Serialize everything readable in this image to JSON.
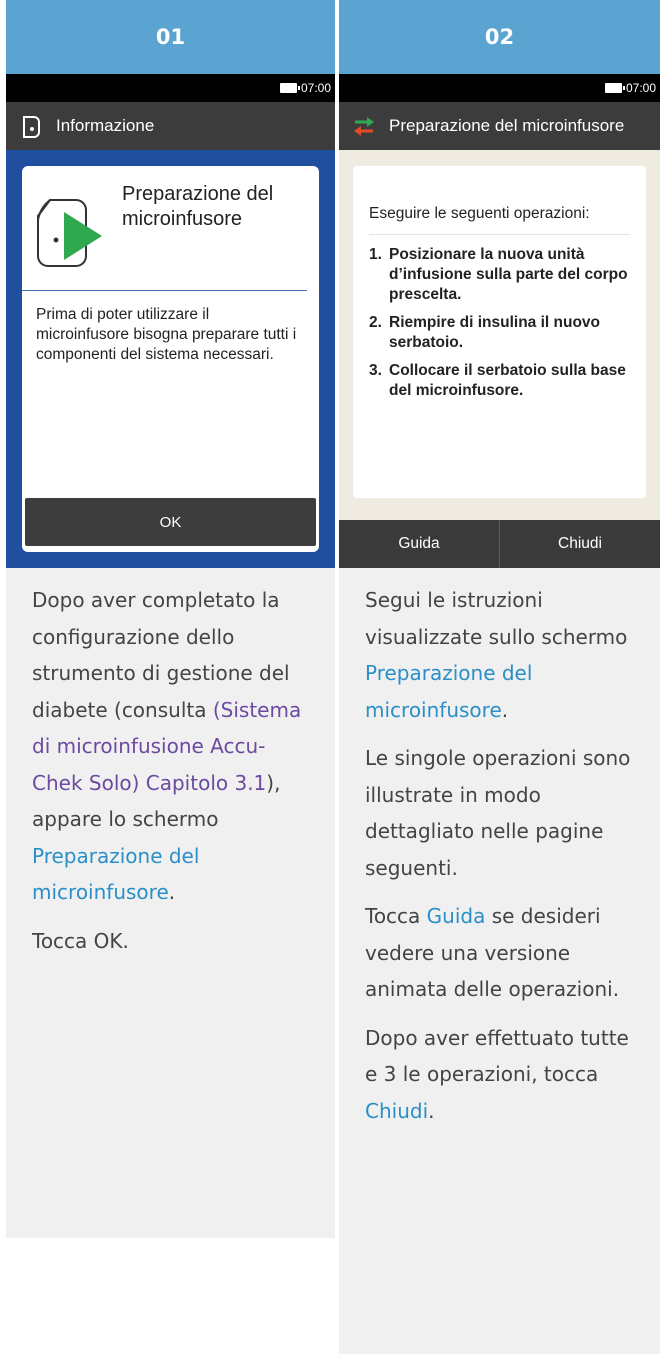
{
  "step1": {
    "number": "01",
    "status_time": "07:00",
    "title": "Informazione",
    "card_title": "Preparazione del microinfusore",
    "card_body": "Prima di poter utilizzare il microinfusore bisogna preparare tutti i componenti del sistema necessari.",
    "ok_label": "OK",
    "desc": {
      "p1_a": "Dopo aver completato la configurazione dello strumento di gestione del diabete (consulta ",
      "p1_link": "(Sistema di microinfusione Accu-Chek Solo) Capitolo 3.1",
      "p1_b": "), appare lo schermo ",
      "p1_link2": "Preparazione del microinfusore",
      "p1_c": ".",
      "p2": "Tocca OK."
    }
  },
  "step2": {
    "number": "02",
    "status_time": "07:00",
    "title": "Preparazione del microinfusore",
    "card_head": "Eseguire le seguenti operazioni:",
    "steps": [
      {
        "n": "1.",
        "text": "Posizionare la nuova unità d’infusione sulla parte del corpo prescelta."
      },
      {
        "n": "2.",
        "text": "Riempire di insulina il nuovo serbatoio."
      },
      {
        "n": "3.",
        "text": "Collocare il serbatoio sulla base del microinfusore."
      }
    ],
    "guide_label": "Guida",
    "close_label": "Chiudi",
    "desc": {
      "p1_a": "Segui le istruzioni visualizzate sullo schermo ",
      "p1_link": "Preparazione del microinfusore",
      "p1_b": ".",
      "p2": "Le singole operazioni sono illustrate in modo dettagliato nelle pagine seguenti.",
      "p3_a": "Tocca ",
      "p3_link": "Guida",
      "p3_b": " se desideri vedere una versione animata delle operazioni.",
      "p4_a": "Dopo aver effettuato tutte e 3 le operazioni, tocca ",
      "p4_link": "Chiudi",
      "p4_b": "."
    }
  }
}
